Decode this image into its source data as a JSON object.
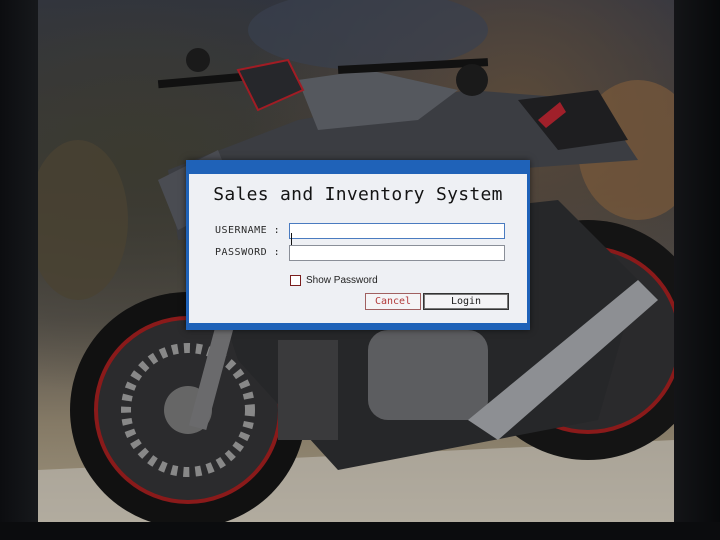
{
  "window": {
    "title": "Sales and Inventory System"
  },
  "form": {
    "username_label": "USERNAME :",
    "username_value": "",
    "password_label": "PASSWORD :",
    "password_value": "",
    "show_password_label": "Show Password",
    "show_password_checked": false
  },
  "buttons": {
    "cancel_label": "Cancel",
    "login_label": "Login"
  },
  "colors": {
    "window_frame": "#1f62b8",
    "window_body": "#eef0f4",
    "cancel_text": "#b23a3a"
  },
  "icons": {
    "mouse_cursor": "arrow-pointer-icon"
  }
}
